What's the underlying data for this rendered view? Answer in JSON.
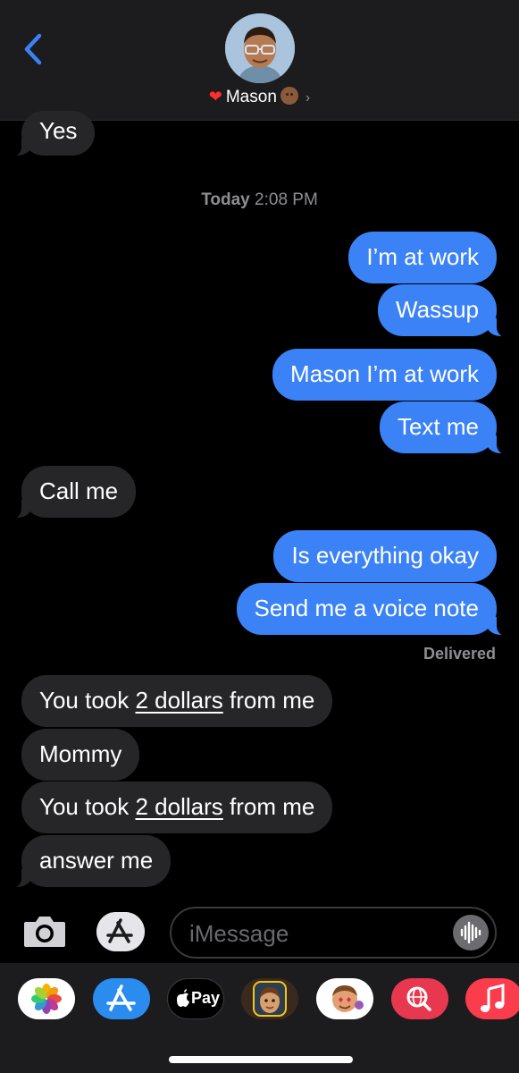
{
  "header": {
    "contact_name": "Mason",
    "heart": "❤",
    "chevron": "›"
  },
  "timestamp": {
    "day": "Today",
    "time": "2:08 PM"
  },
  "messages": [
    {
      "dir": "in",
      "text": "Yes"
    },
    {
      "dir": "out",
      "text": "I’m at work"
    },
    {
      "dir": "out",
      "text": "Wassup"
    },
    {
      "dir": "out",
      "text": "Mason I’m at work"
    },
    {
      "dir": "out",
      "text": "Text me"
    },
    {
      "dir": "in",
      "text": "Call me"
    },
    {
      "dir": "out",
      "text": "Is everything okay"
    },
    {
      "dir": "out",
      "text": "Send me a voice note"
    },
    {
      "dir": "in",
      "pre": "You took ",
      "link": "2 dollars",
      "post": " from me"
    },
    {
      "dir": "in",
      "text": "Mommy"
    },
    {
      "dir": "in",
      "pre": "You took ",
      "link": "2 dollars",
      "post": " from me"
    },
    {
      "dir": "in",
      "text": "answer me"
    }
  ],
  "status": "Delivered",
  "composer": {
    "placeholder": "iMessage"
  },
  "app_drawer": {
    "apps": [
      "photos-app-icon",
      "app-store-icon",
      "apple-pay-icon",
      "memoji-icon",
      "memoji-stickers-icon",
      "search-images-icon",
      "music-icon"
    ],
    "apple_pay_label": "Pay"
  },
  "colors": {
    "outgoing_bubble": "#3b82f6",
    "incoming_bubble": "#262628",
    "accent": "#3b82f6"
  }
}
